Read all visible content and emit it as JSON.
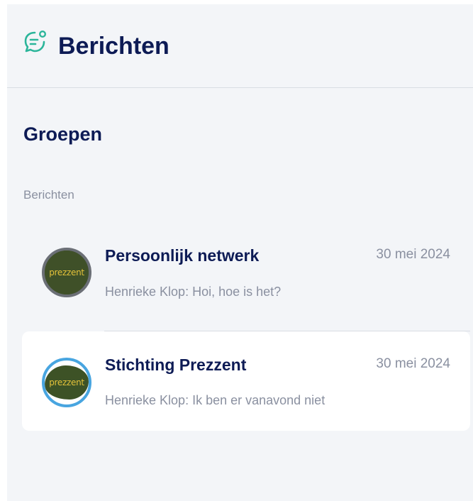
{
  "header": {
    "title": "Berichten",
    "icon": "chat-bubble-icon",
    "accent_color": "#2bb59a"
  },
  "groups": {
    "section_title": "Groepen",
    "subsection_label": "Berichten",
    "conversations": [
      {
        "name": "Persoonlijk netwerk",
        "date": "30 mei 2024",
        "preview": "Henrieke Klop: Hoi, hoe is het?",
        "avatar_text": "prezzent",
        "active": false
      },
      {
        "name": "Stichting Prezzent",
        "date": "30 mei 2024",
        "preview": "Henrieke Klop: Ik ben er vanavond niet",
        "avatar_text": "prezzent",
        "active": true
      }
    ]
  }
}
